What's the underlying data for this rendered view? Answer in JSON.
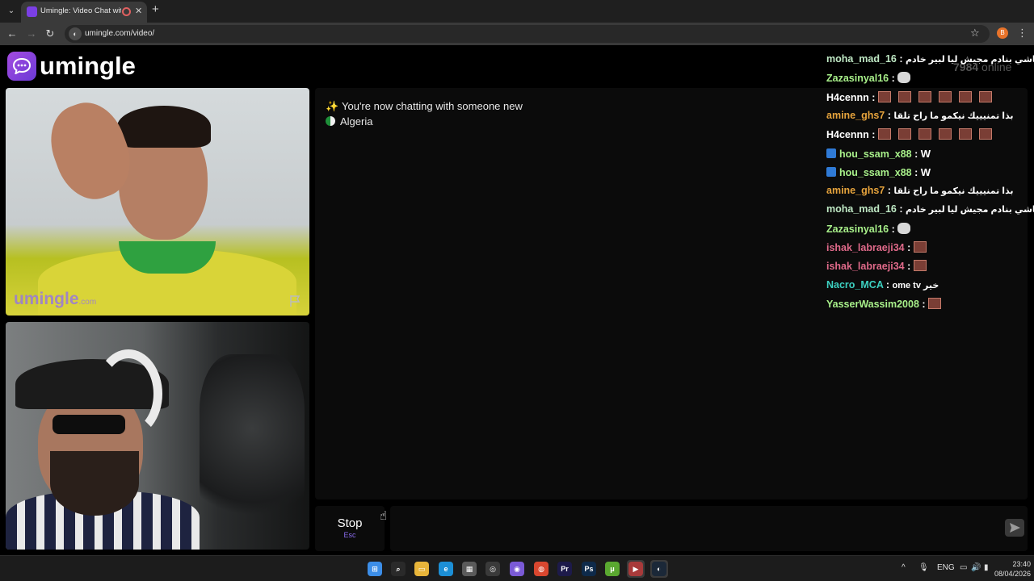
{
  "browser": {
    "tab_title": "Umingle: Video Chat with S",
    "url": "umingle.com/video/",
    "nav": {
      "back": "←",
      "forward": "→",
      "reload": "↻"
    },
    "new_tab_glyph": "+",
    "close_glyph": "✕",
    "menu_glyph": "⌄",
    "bookmark_glyph": "☆",
    "extension_glyph": "B",
    "kebab_glyph": "⋮"
  },
  "site": {
    "logo_text": "umingle",
    "online_count": "7984",
    "online_label": "online"
  },
  "videos": {
    "watermark_main": "umingle",
    "watermark_suffix": ".com"
  },
  "chat": {
    "sys_icon": "✨",
    "sys_message": "You're now chatting with someone new",
    "country": "Algeria",
    "input_placeholder": "",
    "stop_label": "Stop",
    "stop_key": "Esc",
    "send_glyph": "➤",
    "cursor_glyph": "☝"
  },
  "feed": [
    {
      "user": "moha_mad_16",
      "color": "#bfe8c4",
      "msg": "انا ماشي بنادم مجيش ليا لبير خادم",
      "emotes": 0,
      "badge": false,
      "w": false,
      "ghost": false
    },
    {
      "user": "Zazasinyal16",
      "color": "#a8f08a",
      "msg": "",
      "emotes": 0,
      "badge": false,
      "w": false,
      "ghost": true
    },
    {
      "user": "H4cennn",
      "color": "#ffffff",
      "msg": "",
      "emotes": 6,
      "badge": false,
      "w": false,
      "ghost": false
    },
    {
      "user": "amine_ghs7",
      "color": "#e6a33c",
      "msg": "بذا تمنيييك نيكمو ما راح تلقا",
      "emotes": 0,
      "badge": false,
      "w": false,
      "ghost": false
    },
    {
      "user": "H4cennn",
      "color": "#ffffff",
      "msg": "",
      "emotes": 6,
      "badge": false,
      "w": false,
      "ghost": false
    },
    {
      "user": "hou_ssam_x88",
      "color": "#a8f08a",
      "msg": "W",
      "emotes": 0,
      "badge": true,
      "w": true,
      "ghost": false
    },
    {
      "user": "hou_ssam_x88",
      "color": "#a8f08a",
      "msg": "W",
      "emotes": 0,
      "badge": true,
      "w": true,
      "ghost": false
    },
    {
      "user": "amine_ghs7",
      "color": "#e6a33c",
      "msg": "بذا تمنيييك نيكمو ما راح تلقا",
      "emotes": 0,
      "badge": false,
      "w": false,
      "ghost": false
    },
    {
      "user": "moha_mad_16",
      "color": "#bfe8c4",
      "msg": "انا ماشي بنادم مجيش ليا لبير خادم",
      "emotes": 0,
      "badge": false,
      "w": false,
      "ghost": false
    },
    {
      "user": "Zazasinyal16",
      "color": "#a8f08a",
      "msg": "",
      "emotes": 0,
      "badge": false,
      "w": false,
      "ghost": true
    },
    {
      "user": "ishak_labraeji34",
      "color": "#e06a8a",
      "msg": "",
      "emotes": 1,
      "badge": false,
      "w": false,
      "ghost": false
    },
    {
      "user": "ishak_labraeji34",
      "color": "#e06a8a",
      "msg": "",
      "emotes": 1,
      "badge": false,
      "w": false,
      "ghost": false
    },
    {
      "user": "Nacro_MCA",
      "color": "#3cd0c0",
      "msg": "ome tv خير",
      "emotes": 0,
      "badge": false,
      "w": false,
      "ghost": false
    },
    {
      "user": "YasserWassim2008",
      "color": "#a8f08a",
      "msg": "",
      "emotes": 1,
      "badge": false,
      "w": false,
      "ghost": false
    }
  ],
  "taskbar": {
    "apps": [
      {
        "name": "windows-start-icon",
        "glyph": "⊞",
        "color": "#3c8ee8"
      },
      {
        "name": "search-icon",
        "glyph": "⌕",
        "color": "#2a2a2a"
      },
      {
        "name": "file-explorer-icon",
        "glyph": "▭",
        "color": "#e8b53a"
      },
      {
        "name": "edge-icon",
        "glyph": "e",
        "color": "#1c8fd6"
      },
      {
        "name": "store-icon",
        "glyph": "▦",
        "color": "#5a5a5a"
      },
      {
        "name": "app-icon",
        "glyph": "◎",
        "color": "#3a3a3a"
      },
      {
        "name": "chat-app-icon",
        "glyph": "◉",
        "color": "#7a5ad6"
      },
      {
        "name": "chrome-icon",
        "glyph": "◍",
        "color": "#d9472f"
      },
      {
        "name": "premiere-icon",
        "glyph": "Pr",
        "color": "#1d1a4a"
      },
      {
        "name": "photoshop-icon",
        "glyph": "Ps",
        "color": "#0e2a4a"
      },
      {
        "name": "utorrent-icon",
        "glyph": "μ",
        "color": "#5aa830"
      },
      {
        "name": "media-player-icon",
        "glyph": "▶",
        "color": "#a83a3a"
      },
      {
        "name": "steam-icon",
        "glyph": "◐",
        "color": "#1b2838"
      }
    ],
    "tray_chevron": "^",
    "tray_mic": "🎙",
    "tray_lang": "ENG",
    "tray_net": "▭",
    "tray_vol": "🔊",
    "tray_batt": "▮",
    "time": "23:40",
    "date": "08/04/2026"
  }
}
